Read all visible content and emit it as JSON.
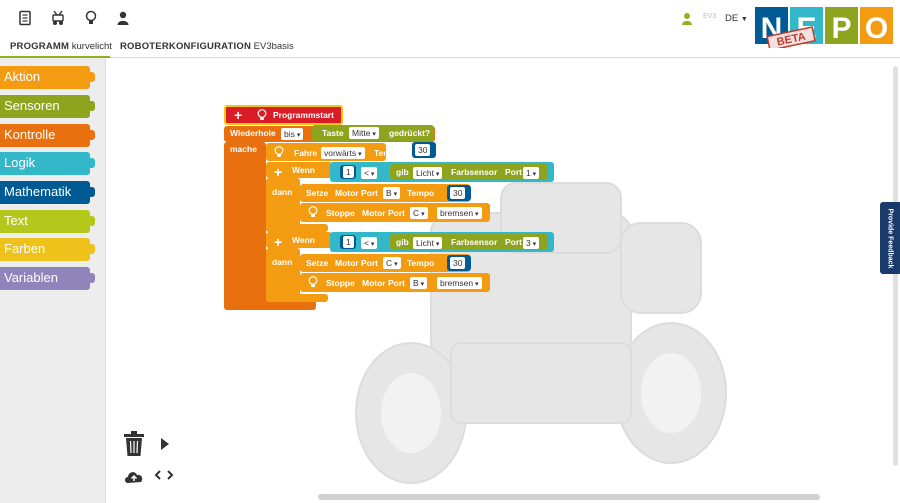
{
  "header": {
    "tabs": [
      {
        "label_strong": "PROGRAMM",
        "label_value": "kurvelicht"
      },
      {
        "label_strong": "ROBOTERKONFIGURATION",
        "label_value": "EV3basis"
      }
    ],
    "robot_label": "EV3",
    "language": "DE",
    "logo_text": "NEPO",
    "logo_badge": "BETA",
    "icons": [
      "document-icon",
      "robot-icon",
      "bulb-icon",
      "user-icon"
    ]
  },
  "toolbox": {
    "categories": [
      {
        "label": "Aktion",
        "color": "#f39c12"
      },
      {
        "label": "Sensoren",
        "color": "#8fa41e"
      },
      {
        "label": "Kontrolle",
        "color": "#e8700e"
      },
      {
        "label": "Logik",
        "color": "#33b8ca"
      },
      {
        "label": "Mathematik",
        "color": "#005a94"
      },
      {
        "label": "Text",
        "color": "#b3c81a"
      },
      {
        "label": "Farben",
        "color": "#eec21a"
      },
      {
        "label": "Variablen",
        "color": "#9085ba"
      }
    ]
  },
  "program": {
    "start": "Programmstart",
    "repeat": "Wiederhole",
    "repeat_mode": "bis",
    "key_label": "Taste",
    "key_value": "Mitte",
    "pressed": "gedrückt?",
    "do": "mache",
    "drive": "Fahre",
    "drive_dir": "vorwärts",
    "speed": "Tempo",
    "drive_speed": "30",
    "if1": {
      "if": "Wenn",
      "left": "1",
      "op": "<",
      "get": "gib",
      "sensor_mode": "Licht",
      "sensor": "Farbsensor",
      "port_label": "Port",
      "port": "1",
      "then": "dann",
      "set": "Setze",
      "motor_port": "Motor Port",
      "set_port": "B",
      "set_speed": "30",
      "stop": "Stoppe",
      "stop_port": "C",
      "stop_mode": "bremsen"
    },
    "if2": {
      "if": "Wenn",
      "left": "1",
      "op": "<",
      "get": "gib",
      "sensor_mode": "Licht",
      "sensor": "Farbsensor",
      "port_label": "Port",
      "port": "3",
      "then": "dann",
      "set": "Setze",
      "motor_port": "Motor Port",
      "set_port": "C",
      "set_speed": "30",
      "stop": "Stoppe",
      "stop_port": "B",
      "stop_mode": "bremsen"
    }
  },
  "feedback_label": "Provide Feedback"
}
